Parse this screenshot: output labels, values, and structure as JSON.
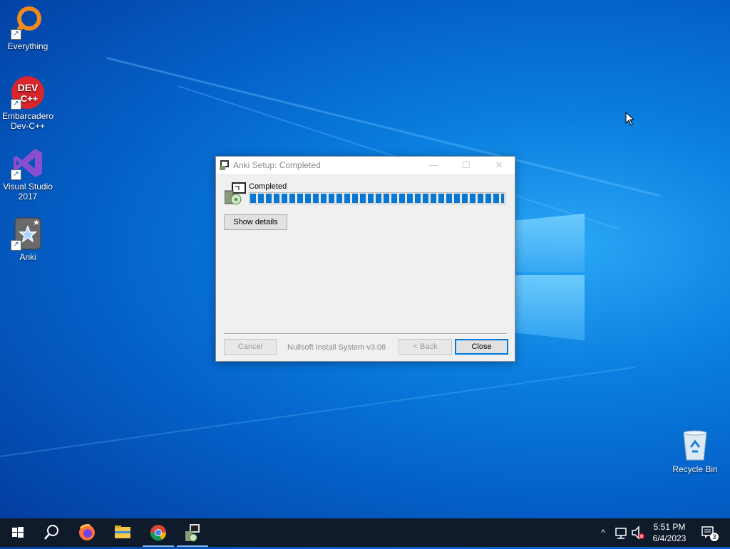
{
  "desktop": {
    "icons": [
      {
        "label": "Everything"
      },
      {
        "label": "Embarcadero Dev-C++"
      },
      {
        "label": "Visual Studio 2017"
      },
      {
        "label": "Anki"
      },
      {
        "label": "Recycle Bin"
      }
    ]
  },
  "window": {
    "title": "Anki Setup: Completed",
    "status_text": "Completed",
    "progress": 1.0,
    "show_details_label": "Show details",
    "cancel_label": "Cancel",
    "branding": "Nullsoft Install System v3.08",
    "back_label": "< Back",
    "close_label": "Close",
    "controls": {
      "minimize": "—",
      "maximize": "☐",
      "close": "✕"
    }
  },
  "taskbar": {
    "apps": [
      "start-icon",
      "search-icon",
      "firefox-icon",
      "file-explorer-icon",
      "chrome-icon",
      "anki-setup-icon"
    ],
    "clock": {
      "time": "5:51 PM",
      "date": "6/4/2023"
    },
    "notification_count": "3",
    "tray_chevron": "^"
  },
  "colors": {
    "accent": "#0078d7",
    "progress": "#0678d4",
    "taskbar": "#0f1a2a"
  }
}
